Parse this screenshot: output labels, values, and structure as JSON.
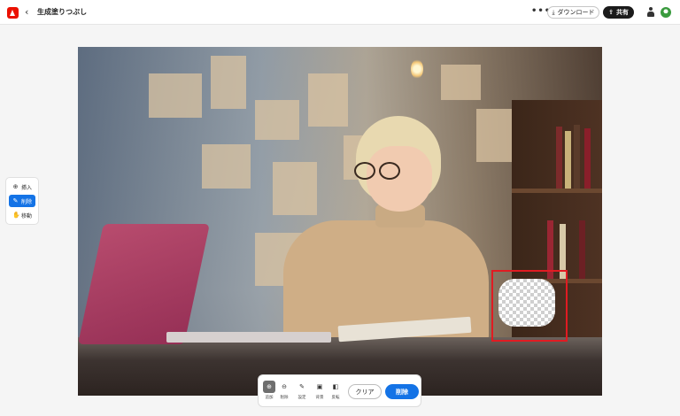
{
  "header": {
    "back_icon": "chevron-left-icon",
    "title": "生成塗りつぶし",
    "more_label": "•••",
    "download_label": "ダウンロード",
    "share_label": "共有"
  },
  "tool_panel": {
    "items": [
      {
        "label": "挿入",
        "icon": "insert-icon",
        "active": false
      },
      {
        "label": "削除",
        "icon": "remove-brush-icon",
        "active": true
      },
      {
        "label": "移動",
        "icon": "hand-icon",
        "active": false
      }
    ]
  },
  "bottom_toolbar": {
    "tools": [
      {
        "label": "追加",
        "icon": "add-brush-icon",
        "active": true
      },
      {
        "label": "削除",
        "icon": "subtract-brush-icon",
        "active": false
      },
      {
        "label": "設定",
        "icon": "brush-settings-icon",
        "active": false
      },
      {
        "label": "背景",
        "icon": "background-icon",
        "active": false
      },
      {
        "label": "反転",
        "icon": "invert-icon",
        "active": false
      }
    ],
    "clear_label": "クリア",
    "erase_label": "削除"
  },
  "colors": {
    "accent": "#1473e6",
    "logo": "#eb1000",
    "selection": "#e11b22"
  }
}
